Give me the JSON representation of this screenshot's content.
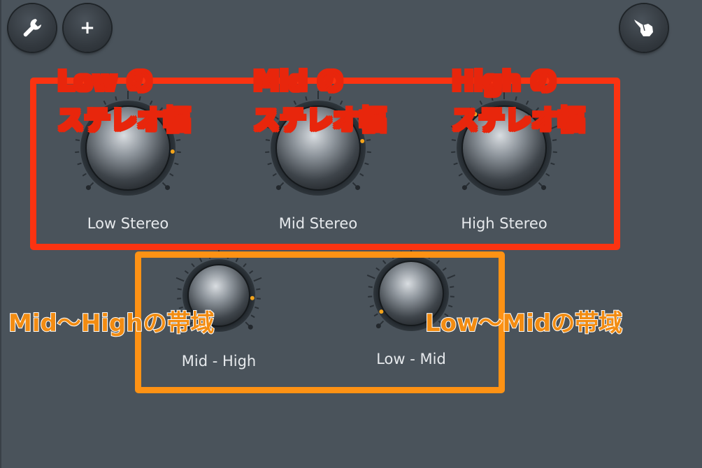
{
  "toolbar": {
    "settings_icon": "wrench-icon",
    "add_label": "+",
    "hand_icon": "pointing-hand-icon"
  },
  "knobs": [
    {
      "id": "low-stereo",
      "label": "Low Stereo",
      "value": 0.85
    },
    {
      "id": "mid-stereo",
      "label": "Mid Stereo",
      "value": 0.8
    },
    {
      "id": "high-stereo",
      "label": "High Stereo",
      "value": 0.35
    },
    {
      "id": "mid-high",
      "label": "Mid - High",
      "value": 0.85
    },
    {
      "id": "low-mid",
      "label": "Low - Mid",
      "value": 0.05
    }
  ],
  "annotations": {
    "low_line1": "Low の",
    "low_line2": "ステレオ幅",
    "mid_line1": "Mid の",
    "mid_line2": "ステレオ幅",
    "high_line1": "High の",
    "high_line2": "ステレオ幅",
    "mid_high_band": "Mid～Highの帯域",
    "low_mid_band": "Low～Midの帯域"
  },
  "colors": {
    "background": "#4a535b",
    "indicator": "#f2a31b",
    "red_box": "#fb3311",
    "orange_box": "#fe9214"
  }
}
